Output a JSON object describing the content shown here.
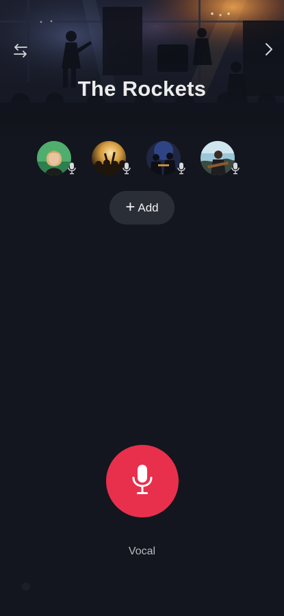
{
  "header": {
    "title": "The Rockets",
    "background": "concert-stage-photo",
    "left_icon": "swap-arrows-icon",
    "right_icon": "chevron-right-icon"
  },
  "members": [
    {
      "avatar": "woman-portrait-photo",
      "badge_icon": "microphone-icon"
    },
    {
      "avatar": "concert-crowd-photo",
      "badge_icon": "microphone-icon"
    },
    {
      "avatar": "band-stage-photo",
      "badge_icon": "microphone-icon"
    },
    {
      "avatar": "guitarist-photo",
      "badge_icon": "microphone-icon"
    }
  ],
  "add_button": {
    "icon": "plus-icon",
    "label": "Add"
  },
  "record": {
    "icon": "microphone-icon",
    "label": "Vocal"
  },
  "colors": {
    "background": "#13161e",
    "accent": "#e8304c",
    "pill": "#2a2e37"
  }
}
